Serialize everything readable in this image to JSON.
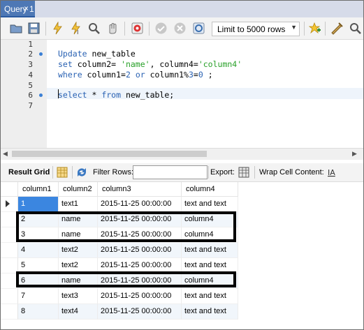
{
  "tabs": [
    {
      "label": "Query 1",
      "close": "×"
    }
  ],
  "toolbar": {
    "limit_label": "Limit to 5000 rows",
    "icons": [
      "open-folder-icon",
      "save-icon",
      "execute-icon",
      "execute-current-icon",
      "explain-icon",
      "stop-icon",
      "toggle-error-icon",
      "commit-icon",
      "rollback-icon",
      "autocommit-icon",
      "bookmark-star-icon",
      "beautify-icon",
      "find-icon"
    ]
  },
  "editor": {
    "line_numbers": [
      "1",
      "2",
      "3",
      "4",
      "5",
      "6",
      "7"
    ],
    "lines": [
      {
        "n": "1",
        "segments": []
      },
      {
        "n": "2",
        "segments": [
          {
            "t": "Update",
            "c": "kw"
          },
          {
            "t": " new_table",
            "c": "ident"
          }
        ]
      },
      {
        "n": "3",
        "segments": [
          {
            "t": "set",
            "c": "kw"
          },
          {
            "t": " column2= ",
            "c": "ident"
          },
          {
            "t": "'name'",
            "c": "str"
          },
          {
            "t": ", column4=",
            "c": "ident"
          },
          {
            "t": "'column4'",
            "c": "str"
          }
        ]
      },
      {
        "n": "4",
        "segments": [
          {
            "t": "where",
            "c": "kw"
          },
          {
            "t": " column1=",
            "c": "ident"
          },
          {
            "t": "2",
            "c": "num"
          },
          {
            "t": " ",
            "c": "ident"
          },
          {
            "t": "or",
            "c": "kw"
          },
          {
            "t": " column1%",
            "c": "ident"
          },
          {
            "t": "3",
            "c": "num"
          },
          {
            "t": "=",
            "c": "ident"
          },
          {
            "t": "0",
            "c": "num"
          },
          {
            "t": " ;",
            "c": "ident"
          }
        ]
      },
      {
        "n": "5",
        "segments": []
      },
      {
        "n": "6",
        "segments": [
          {
            "t": "select",
            "c": "kw"
          },
          {
            "t": " * ",
            "c": "ident"
          },
          {
            "t": "from",
            "c": "kw"
          },
          {
            "t": " new_table;",
            "c": "ident"
          }
        ]
      },
      {
        "n": "7",
        "segments": []
      }
    ]
  },
  "result_bar": {
    "result_grid": "Result Grid",
    "filter_rows": "Filter Rows:",
    "filter_value": "",
    "export": "Export:",
    "wrap": "Wrap Cell Content:"
  },
  "grid": {
    "columns": [
      "column1",
      "column2",
      "column3",
      "column4"
    ],
    "rows": [
      [
        "1",
        "text1",
        "2015-11-25 00:00:00",
        "text and text"
      ],
      [
        "2",
        "name",
        "2015-11-25 00:00:00",
        "column4"
      ],
      [
        "3",
        "name",
        "2015-11-25 00:00:00",
        "column4"
      ],
      [
        "4",
        "text2",
        "2015-11-25 00:00:00",
        "text and text"
      ],
      [
        "5",
        "text2",
        "2015-11-25 00:00:00",
        "text and text"
      ],
      [
        "6",
        "name",
        "2015-11-25 00:00:00",
        "column4"
      ],
      [
        "7",
        "text3",
        "2015-11-25 00:00:00",
        "text and text"
      ],
      [
        "8",
        "text4",
        "2015-11-25 00:00:00",
        "text and text"
      ]
    ],
    "highlighted_rows": [
      [
        "2",
        "3"
      ],
      [
        "6"
      ]
    ]
  },
  "colors": {
    "accent": "#3b86e0",
    "tab": "#4e78b5",
    "keyword": "#2a62b3",
    "string": "#28a028"
  }
}
